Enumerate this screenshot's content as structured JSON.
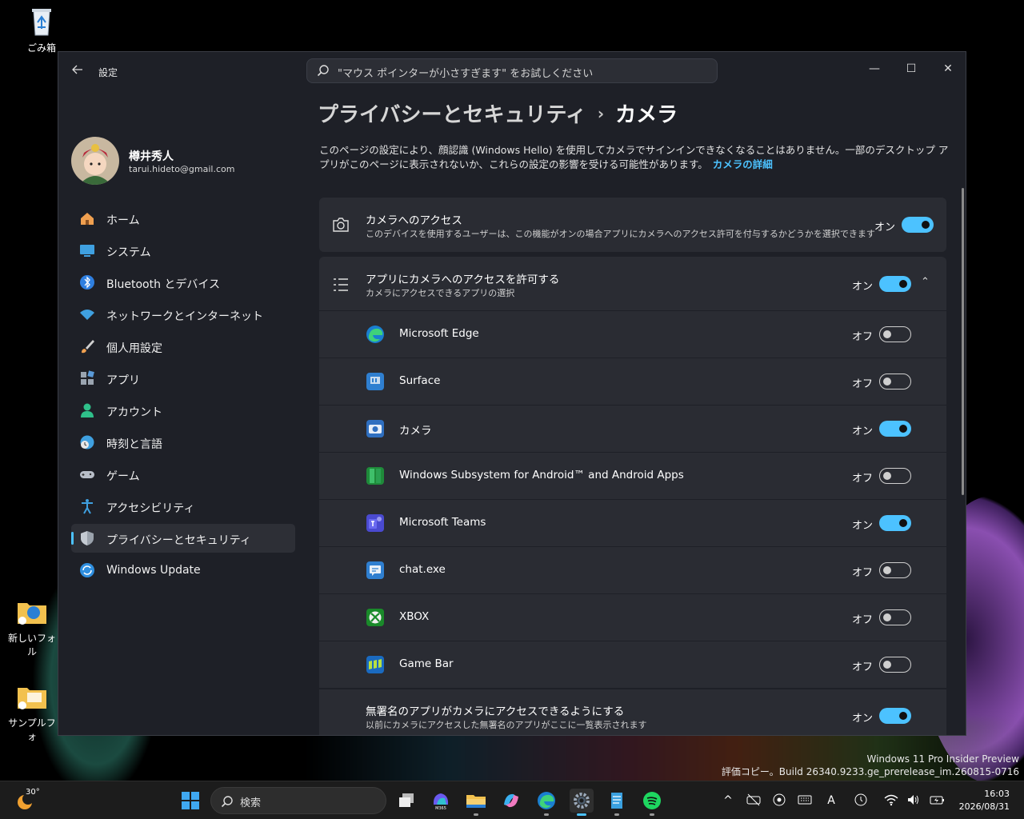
{
  "desktop": {
    "icons": [
      {
        "label": "ごみ箱"
      },
      {
        "label": "新しいフォル"
      },
      {
        "label": "サンプルフォ"
      }
    ],
    "watermark": {
      "line1": "Windows 11 Pro Insider Preview",
      "line2": "評価コピー。Build 26340.9233.ge_prerelease_im.260815-0716"
    }
  },
  "window": {
    "back_icon": "arrow-left-icon",
    "title": "設定",
    "search_placeholder": "\"マウス ポインターが小さすぎます\" をお試しください",
    "controls": {
      "minimize": "—",
      "maximize": "☐",
      "close": "✕"
    }
  },
  "user": {
    "name": "樽井秀人",
    "email": "tarui.hideto@gmail.com"
  },
  "sidebar": {
    "items": [
      {
        "label": "ホーム",
        "icon": "home-icon"
      },
      {
        "label": "システム",
        "icon": "monitor-icon"
      },
      {
        "label": "Bluetooth とデバイス",
        "icon": "bluetooth-icon"
      },
      {
        "label": "ネットワークとインターネット",
        "icon": "wifi-icon"
      },
      {
        "label": "個人用設定",
        "icon": "brush-icon"
      },
      {
        "label": "アプリ",
        "icon": "apps-icon"
      },
      {
        "label": "アカウント",
        "icon": "person-icon"
      },
      {
        "label": "時刻と言語",
        "icon": "globe-clock-icon"
      },
      {
        "label": "ゲーム",
        "icon": "gamepad-icon"
      },
      {
        "label": "アクセシビリティ",
        "icon": "accessibility-icon"
      },
      {
        "label": "プライバシーとセキュリティ",
        "icon": "shield-icon",
        "active": true
      },
      {
        "label": "Windows Update",
        "icon": "update-icon"
      }
    ]
  },
  "page": {
    "breadcrumb_parent": "プライバシーとセキュリティ",
    "breadcrumb_sep": "›",
    "breadcrumb_current": "カメラ",
    "description": "このページの設定により、顔認識 (Windows Hello) を使用してカメラでサインインできなくなることはありません。一部のデスクトップ アプリがこのページに表示されないか、これらの設定の影響を受ける可能性があります。",
    "description_link": "カメラの詳細",
    "camera_access": {
      "title": "カメラへのアクセス",
      "subtitle": "このデバイスを使用するユーザーは、この機能がオンの場合アプリにカメラへのアクセス許可を付与するかどうかを選択できます",
      "state": "オン"
    },
    "app_access": {
      "title": "アプリにカメラへのアクセスを許可する",
      "subtitle": "カメラにアクセスできるアプリの選択",
      "state": "オン",
      "chevron": "⌃"
    },
    "apps": [
      {
        "name": "Microsoft Edge",
        "state": "オフ",
        "on": false
      },
      {
        "name": "Surface",
        "state": "オフ",
        "on": false
      },
      {
        "name": "カメラ",
        "state": "オン",
        "on": true
      },
      {
        "name": "Windows Subsystem for Android™ and Android Apps",
        "state": "オフ",
        "on": false
      },
      {
        "name": "Microsoft Teams",
        "state": "オン",
        "on": true
      },
      {
        "name": "chat.exe",
        "state": "オフ",
        "on": false
      },
      {
        "name": "XBOX",
        "state": "オフ",
        "on": false
      },
      {
        "name": "Game Bar",
        "state": "オフ",
        "on": false
      }
    ],
    "unnamed_apps": {
      "title": "無署名のアプリがカメラにアクセスできるようにする",
      "subtitle": "以前にカメラにアクセスした無署名のアプリがここに一覧表示されます",
      "state": "オン"
    }
  },
  "taskbar": {
    "temperature": "30°",
    "search_label": "検索",
    "clock_time": "16:03",
    "clock_date": "2026/08/31",
    "ime_indicator": "A",
    "overflow_chevron": "^"
  },
  "colors": {
    "accent": "#4cc2ff",
    "window_bg": "#1e2027",
    "card_bg": "#2a2c33"
  }
}
